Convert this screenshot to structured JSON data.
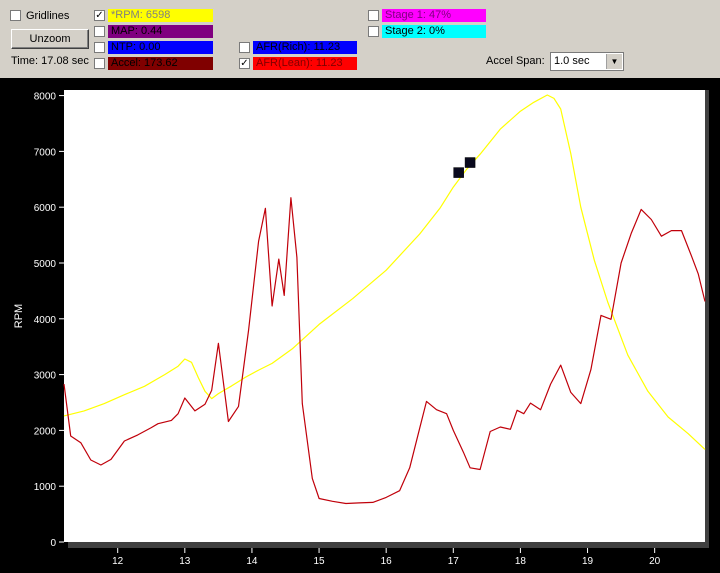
{
  "toolbar": {
    "gridlines": {
      "label": "Gridlines",
      "checked": false
    },
    "unzoom_label": "Unzoom",
    "time_text": "Time: 17.08 sec",
    "accel_span_label": "Accel Span:",
    "accel_span_value": "1.0 sec"
  },
  "channels": {
    "rpm": {
      "text": "*RPM: 6598",
      "color": "#ffff00",
      "checked": true
    },
    "map": {
      "text": "MAP: 0.44",
      "color": "#800080",
      "checked": false
    },
    "ntp": {
      "text": "NTP: 0.00",
      "color": "#0000ff",
      "checked": false
    },
    "accel": {
      "text": "Accel: 173.62",
      "color": "#800000",
      "checked": false
    },
    "afr_rich": {
      "text": "AFR(Rich): 11.23",
      "color": "#0000ff",
      "checked": false
    },
    "afr_lean": {
      "text": "AFR(Lean): 11.23",
      "color": "#ff0000",
      "checked": true
    },
    "stage1": {
      "text": "Stage 1: 47%",
      "color": "#ff00ff",
      "checked": false
    },
    "stage2": {
      "text": "Stage 2: 0%",
      "color": "#00ffff",
      "checked": false
    }
  },
  "check_mark": "✓",
  "arrow_glyph": "▼",
  "chart_data": {
    "type": "line",
    "ylabel": "RPM",
    "xlim": [
      11.2,
      20.75
    ],
    "ylim": [
      0,
      8100
    ],
    "x_ticks": [
      12,
      13,
      14,
      15,
      16,
      17,
      18,
      19,
      20
    ],
    "y_ticks": [
      0,
      1000,
      2000,
      3000,
      4000,
      5000,
      6000,
      7000,
      8000
    ],
    "grid": false,
    "series": [
      {
        "name": "RPM",
        "color": "#ffff00",
        "points": [
          [
            11.2,
            2260
          ],
          [
            11.5,
            2350
          ],
          [
            11.8,
            2480
          ],
          [
            12.1,
            2640
          ],
          [
            12.4,
            2790
          ],
          [
            12.7,
            3000
          ],
          [
            12.9,
            3150
          ],
          [
            13.0,
            3280
          ],
          [
            13.1,
            3220
          ],
          [
            13.2,
            2950
          ],
          [
            13.3,
            2700
          ],
          [
            13.4,
            2570
          ],
          [
            13.5,
            2660
          ],
          [
            13.7,
            2800
          ],
          [
            13.9,
            2950
          ],
          [
            14.1,
            3080
          ],
          [
            14.3,
            3200
          ],
          [
            14.6,
            3460
          ],
          [
            15.0,
            3900
          ],
          [
            15.5,
            4360
          ],
          [
            16.0,
            4870
          ],
          [
            16.5,
            5520
          ],
          [
            16.8,
            5980
          ],
          [
            17.0,
            6360
          ],
          [
            17.2,
            6680
          ],
          [
            17.4,
            6950
          ],
          [
            17.7,
            7400
          ],
          [
            18.0,
            7720
          ],
          [
            18.2,
            7880
          ],
          [
            18.4,
            8010
          ],
          [
            18.5,
            7950
          ],
          [
            18.6,
            7760
          ],
          [
            18.75,
            6960
          ],
          [
            18.9,
            6000
          ],
          [
            19.1,
            5050
          ],
          [
            19.3,
            4300
          ],
          [
            19.6,
            3350
          ],
          [
            19.9,
            2700
          ],
          [
            20.2,
            2240
          ],
          [
            20.5,
            1940
          ],
          [
            20.75,
            1660
          ]
        ]
      },
      {
        "name": "AFR(Lean)",
        "color": "#c0000a",
        "points": [
          [
            11.2,
            2830
          ],
          [
            11.3,
            1900
          ],
          [
            11.45,
            1780
          ],
          [
            11.6,
            1470
          ],
          [
            11.75,
            1380
          ],
          [
            11.9,
            1480
          ],
          [
            12.1,
            1810
          ],
          [
            12.3,
            1920
          ],
          [
            12.5,
            2050
          ],
          [
            12.6,
            2120
          ],
          [
            12.8,
            2180
          ],
          [
            12.9,
            2300
          ],
          [
            13.0,
            2580
          ],
          [
            13.15,
            2350
          ],
          [
            13.3,
            2470
          ],
          [
            13.4,
            2720
          ],
          [
            13.5,
            3560
          ],
          [
            13.65,
            2160
          ],
          [
            13.8,
            2430
          ],
          [
            13.95,
            3800
          ],
          [
            14.1,
            5390
          ],
          [
            14.2,
            5980
          ],
          [
            14.3,
            4230
          ],
          [
            14.4,
            5070
          ],
          [
            14.48,
            4420
          ],
          [
            14.58,
            6170
          ],
          [
            14.67,
            5100
          ],
          [
            14.75,
            2480
          ],
          [
            14.9,
            1140
          ],
          [
            15.0,
            780
          ],
          [
            15.2,
            730
          ],
          [
            15.4,
            690
          ],
          [
            15.6,
            700
          ],
          [
            15.8,
            710
          ],
          [
            16.0,
            800
          ],
          [
            16.2,
            920
          ],
          [
            16.35,
            1330
          ],
          [
            16.5,
            2040
          ],
          [
            16.6,
            2520
          ],
          [
            16.75,
            2370
          ],
          [
            16.9,
            2300
          ],
          [
            17.0,
            2000
          ],
          [
            17.15,
            1610
          ],
          [
            17.25,
            1330
          ],
          [
            17.4,
            1300
          ],
          [
            17.55,
            1980
          ],
          [
            17.7,
            2060
          ],
          [
            17.85,
            2020
          ],
          [
            17.95,
            2360
          ],
          [
            18.05,
            2300
          ],
          [
            18.15,
            2490
          ],
          [
            18.3,
            2370
          ],
          [
            18.45,
            2830
          ],
          [
            18.6,
            3170
          ],
          [
            18.75,
            2680
          ],
          [
            18.9,
            2480
          ],
          [
            19.05,
            3090
          ],
          [
            19.2,
            4060
          ],
          [
            19.35,
            3990
          ],
          [
            19.5,
            5000
          ],
          [
            19.65,
            5530
          ],
          [
            19.8,
            5960
          ],
          [
            19.95,
            5780
          ],
          [
            20.1,
            5480
          ],
          [
            20.25,
            5580
          ],
          [
            20.4,
            5580
          ],
          [
            20.55,
            5120
          ],
          [
            20.65,
            4800
          ],
          [
            20.75,
            4310
          ]
        ]
      }
    ],
    "markers": [
      [
        17.08,
        6620
      ],
      [
        17.25,
        6800
      ]
    ]
  }
}
